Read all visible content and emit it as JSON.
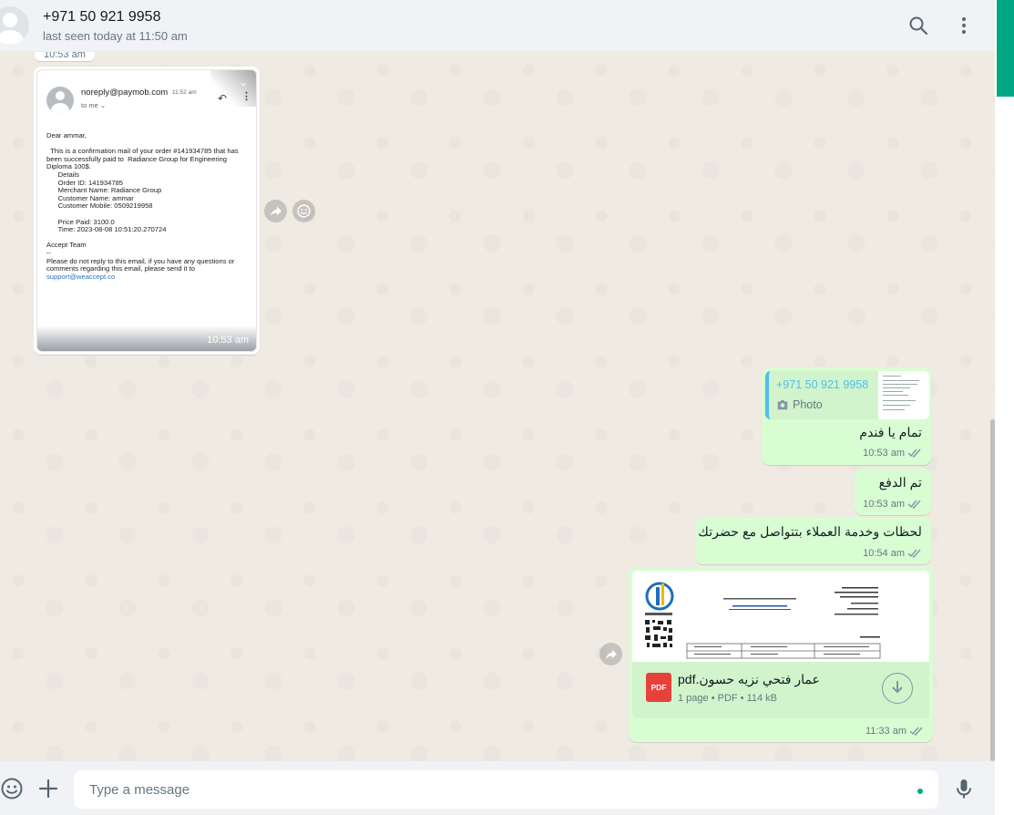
{
  "header": {
    "title": "+971 50 921 9958",
    "subtitle": "last seen today at 11:50 am"
  },
  "chat": {
    "date_chip": "10:53 am",
    "email_image": {
      "from": "noreply@paymob.com",
      "time": "11:52 am",
      "to": "to me",
      "body": "Dear ammar,\n\n  This is a confirmation mail of your order #141934785 that has been successfully paid to  Radiance Group for Engineering Diploma 100$.\n      Details\n      Order ID: 141934785\n      Merchant Name: Radiance Group\n      Customer Name: ammar\n      Customer Mobile: 0509219958\n\n      Price Paid: 3100.0\n      Time: 2023-08-08 10:51:20.270724\n\nAccept Team\n--\nPlease do not reply to this email, if you have any questions or comments regarding this email, please send it to ",
      "link": "support@weaccept.co",
      "bubble_time": "10:53 am"
    },
    "messages": [
      {
        "quote_name": "+971 50 921 9958",
        "quote_type": "Photo",
        "text": "تمام يا فندم",
        "time": "10:53 am"
      },
      {
        "text": "تم الدفع",
        "time": "10:53 am"
      },
      {
        "text": "لحظات وخدمة العملاء بتتواصل مع حضرتك",
        "time": "10:54 am"
      }
    ],
    "pdf": {
      "badge": "PDF",
      "filename": "عمار فتحي نزيه حسون.pdf",
      "meta": "1 page • PDF • 114 kB",
      "time": "11:33 am"
    }
  },
  "footer": {
    "placeholder": "Type a message"
  },
  "colors": {
    "bubble_out": "#d9fdd3",
    "accent": "#00a884",
    "tick": "#8696a0",
    "quote_bar": "#53bdeb"
  }
}
